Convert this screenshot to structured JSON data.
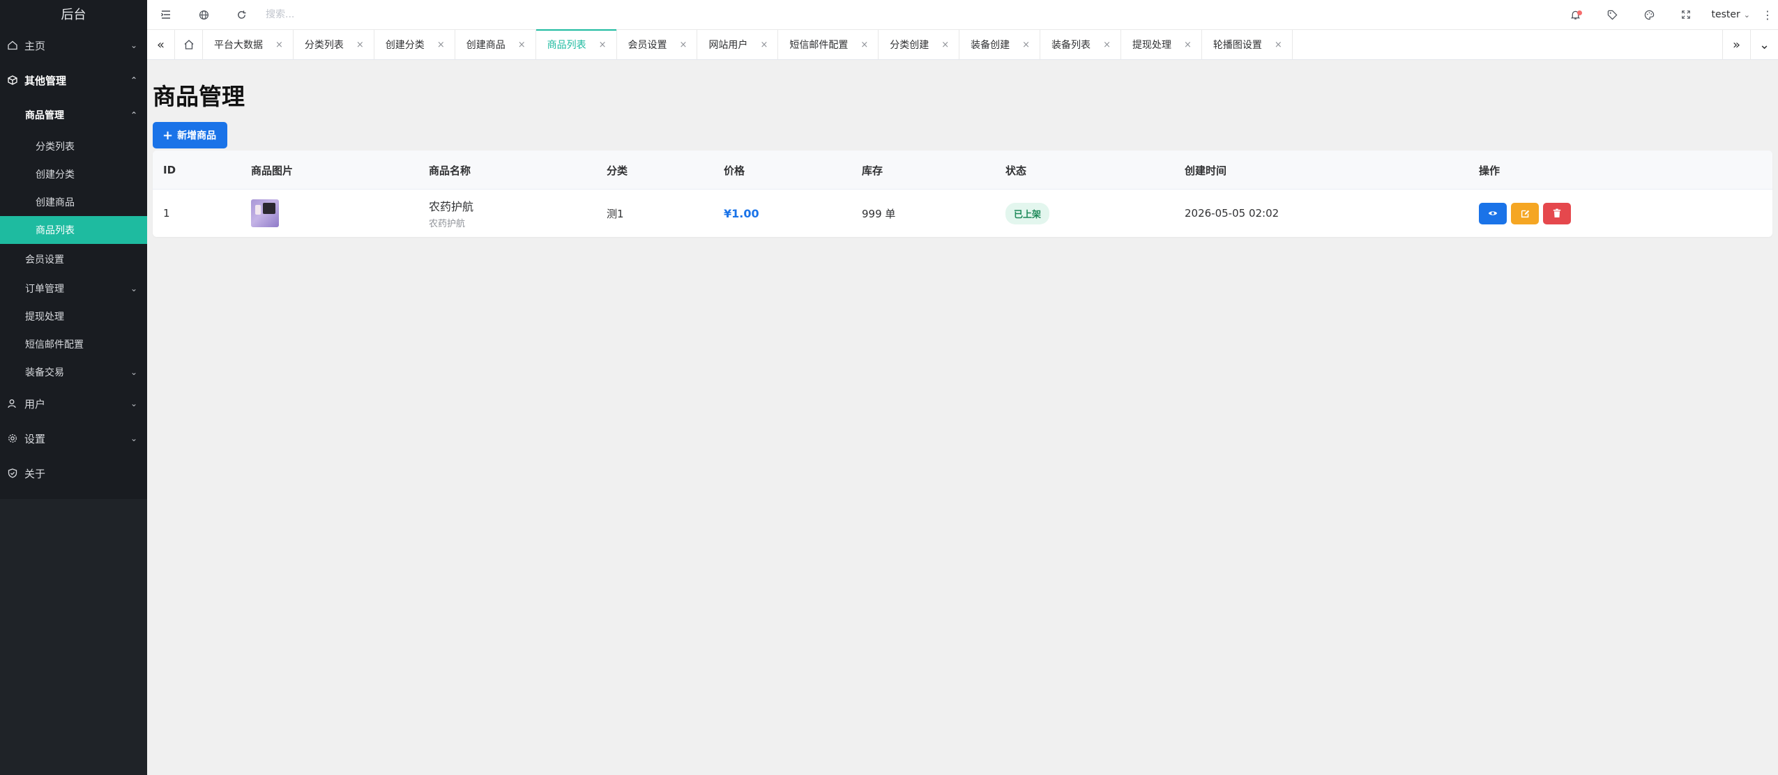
{
  "sidebar": {
    "logo": "后台",
    "home": "主页",
    "other_mgmt": "其他管理",
    "product_mgmt": "商品管理",
    "leaves": [
      "分类列表",
      "创建分类",
      "创建商品",
      "商品列表"
    ],
    "member_settings": "会员设置",
    "order_mgmt": "订单管理",
    "withdraw": "提现处理",
    "sms_mail": "短信邮件配置",
    "equipment_trade": "装备交易",
    "users": "用户",
    "settings": "设置",
    "about": "关于"
  },
  "topbar": {
    "search_placeholder": "搜索...",
    "username": "tester"
  },
  "tabs": [
    "平台大数据",
    "分类列表",
    "创建分类",
    "创建商品",
    "商品列表",
    "会员设置",
    "网站用户",
    "短信邮件配置",
    "分类创建",
    "装备创建",
    "装备列表",
    "提现处理",
    "轮播图设置"
  ],
  "active_tab": "商品列表",
  "page": {
    "title": "商品管理",
    "add_button": "新增商品"
  },
  "table": {
    "headers": [
      "ID",
      "商品图片",
      "商品名称",
      "分类",
      "价格",
      "库存",
      "状态",
      "创建时间",
      "操作"
    ],
    "rows": [
      {
        "id": "1",
        "name": "农药护航",
        "subname": "农药护航",
        "category": "测1",
        "price": "¥1.00",
        "stock": "999 单",
        "status": "已上架",
        "created": "2026-05-05 02:02"
      }
    ]
  },
  "colors": {
    "accent": "#1ebba0",
    "primary": "#1a73e8",
    "warning": "#f5a623",
    "danger": "#e5484d",
    "sidebar_bg": "#191c21"
  }
}
